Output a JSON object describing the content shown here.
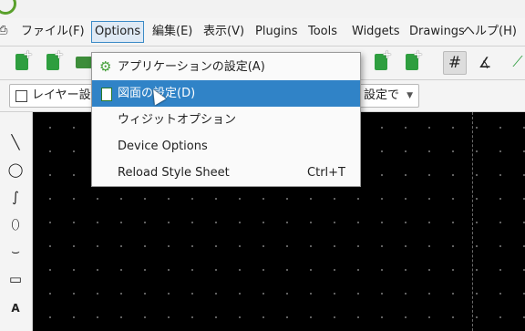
{
  "menubar": {
    "items": [
      {
        "label": "ファイル(F)"
      },
      {
        "label": "Options"
      },
      {
        "label": "編集(E)"
      },
      {
        "label": "表示(V)"
      },
      {
        "label": "Plugins"
      },
      {
        "label": "Tools"
      },
      {
        "label": "Widgets"
      },
      {
        "label": "Drawings"
      },
      {
        "label": "ヘルプ(H)"
      }
    ]
  },
  "toolbar2": {
    "layer_combo": "レイヤー設",
    "combo2": "設定で"
  },
  "dropdown": {
    "items": [
      {
        "label": "アプリケーションの設定(A)",
        "shortcut": ""
      },
      {
        "label": "図面の設定(D)",
        "shortcut": ""
      },
      {
        "label": "ウィジットオプション",
        "shortcut": ""
      },
      {
        "label": "Device Options",
        "shortcut": ""
      },
      {
        "label": "Reload Style Sheet",
        "shortcut": "Ctrl+T"
      }
    ]
  },
  "colors": {
    "accent": "#3083c7",
    "canvas": "#000000",
    "icon_green": "#2e9e3f"
  }
}
